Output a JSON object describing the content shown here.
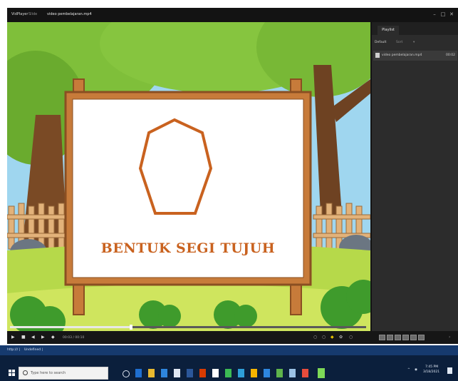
{
  "window": {
    "app_name": "VidPlayer",
    "file_label": "Slide",
    "doc_title": "video pembelajaran.mp4",
    "controls": {
      "minimize": "–",
      "maximize": "□",
      "close": "✕"
    }
  },
  "stage": {
    "board_title": "BENTUK SEGI TUJUH",
    "shape": "heptagon"
  },
  "side_panel": {
    "tab_label": "Playlist",
    "dropdown_label": "Default",
    "dropdown_value": "Sort",
    "items": [
      {
        "label": "video pembelajaran.mp4",
        "duration": "00:02"
      }
    ]
  },
  "player": {
    "progress": 0.34,
    "time_display": "00:03 / 00:10",
    "icons": [
      "play-icon",
      "stop-icon",
      "previous-icon",
      "next-icon",
      "volume-icon"
    ]
  },
  "taskbar": {
    "top_left_a": "http:///  |",
    "top_left_b": "Undefined  |",
    "search_placeholder": "Type here to search",
    "time": "7:45 PM",
    "date": "3/18/2021",
    "colors": {
      "bg": "#0b1f3c",
      "accent": "#163a6e"
    }
  }
}
